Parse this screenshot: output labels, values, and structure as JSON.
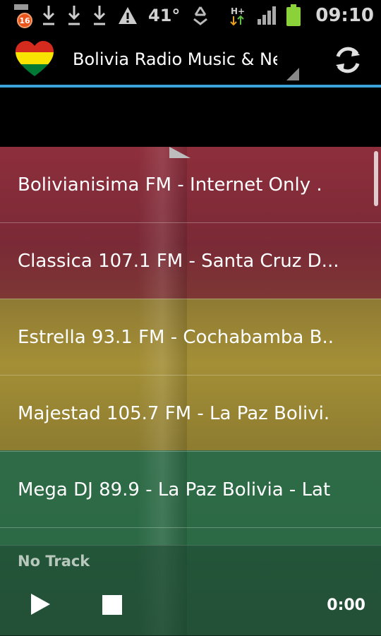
{
  "status_bar": {
    "notification_count": "16",
    "temperature": "41°",
    "network_type": "H+",
    "time": "09:10"
  },
  "action_bar": {
    "title": "Bolivia Radio Music & News",
    "accent_color": "#3aa3d9"
  },
  "stations": [
    {
      "label": "Bolivianisima FM -   Internet Only ."
    },
    {
      "label": "Classica 107.1 FM -  Santa Cruz D..."
    },
    {
      "label": "Estrella 93.1 FM -  Cochabamba B.."
    },
    {
      "label": "Majestad 105.7 FM -   La Paz Bolivi."
    },
    {
      "label": "Mega DJ 89.9 - La Paz Bolivia -   Lat"
    }
  ],
  "player": {
    "track": "No Track",
    "elapsed": "0:00"
  },
  "flag_colors": {
    "red": "#8e2e3c",
    "yellow": "#a48f36",
    "green": "#2c6a45"
  }
}
